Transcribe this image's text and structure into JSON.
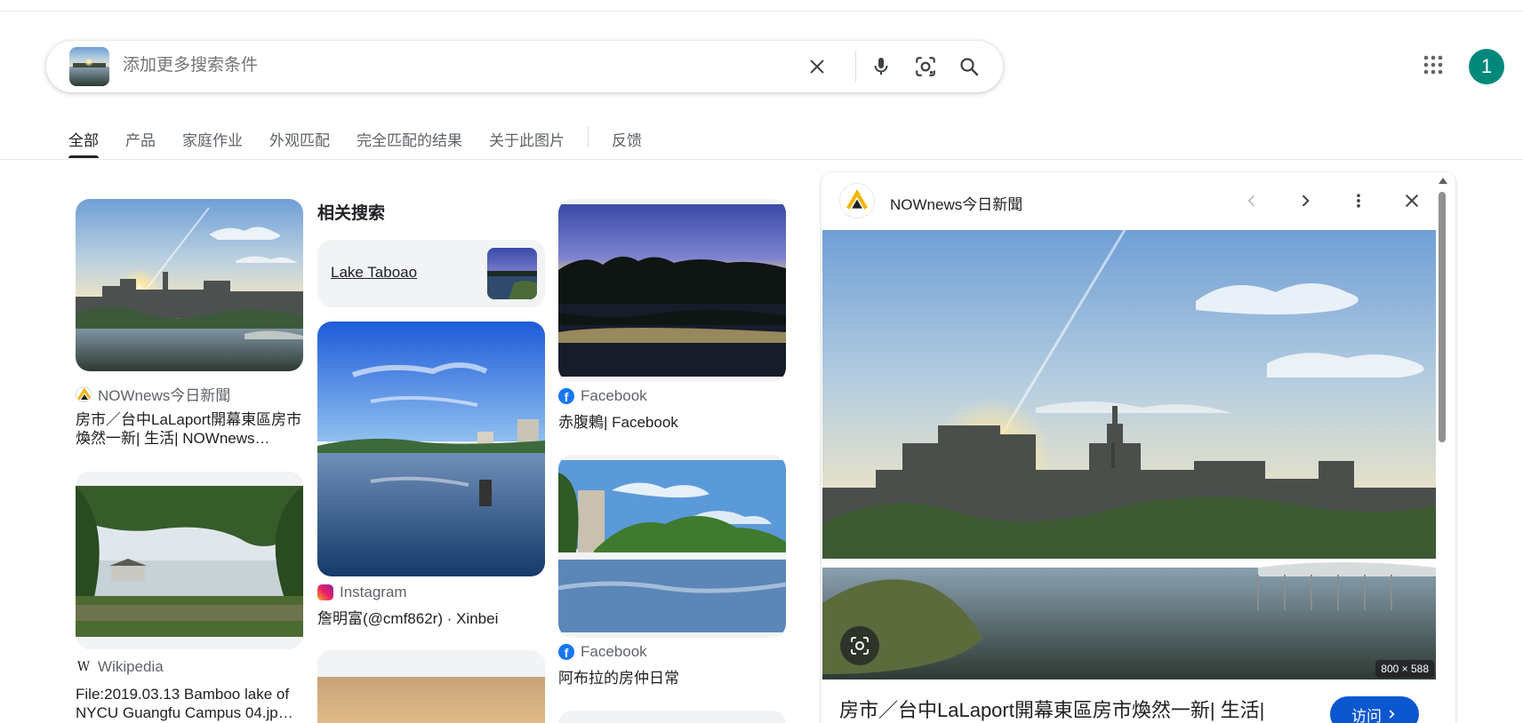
{
  "search": {
    "placeholder": "添加更多搜索条件",
    "icons": [
      "clear-icon",
      "microphone-icon",
      "camera-lens-icon",
      "search-icon"
    ]
  },
  "header": {
    "apps_icon": "apps-grid-icon",
    "avatar_letter": "1"
  },
  "tabs": [
    {
      "label": "全部",
      "active": true
    },
    {
      "label": "产品"
    },
    {
      "label": "家庭作业"
    },
    {
      "label": "外观匹配"
    },
    {
      "label": "完全匹配的结果"
    },
    {
      "label": "关于此图片"
    },
    {
      "label": "反馈"
    }
  ],
  "related": {
    "heading": "相关搜索",
    "chip_label": "Lake Taboao"
  },
  "results": [
    {
      "source": "NOWnews今日新聞",
      "title": "房市／台中LaLaport開幕東區房市煥然一新| 生活| NOWnews…"
    },
    {
      "source": "Wikipedia",
      "title": "File:2019.03.13 Bamboo lake of NYCU Guangfu Campus 04.jp…"
    },
    {
      "source": "Instagram",
      "title": "詹明富(@cmf862r) · Xinbei"
    },
    {
      "source": "Facebook",
      "title": "赤腹鶇| Facebook"
    },
    {
      "source": "Facebook",
      "title": "阿布拉的房仲日常"
    }
  ],
  "panel": {
    "source": "NOWnews今日新聞",
    "dimensions": "800 × 588",
    "title": "房市／台中LaLaport開幕東區房市煥然一新| 生活|",
    "visit_label": "访问",
    "icons": [
      "chevron-left-icon",
      "chevron-right-icon",
      "more-vert-icon",
      "close-icon"
    ]
  },
  "colors": {
    "accent": "#0b57d0",
    "avatar": "#00897b"
  }
}
